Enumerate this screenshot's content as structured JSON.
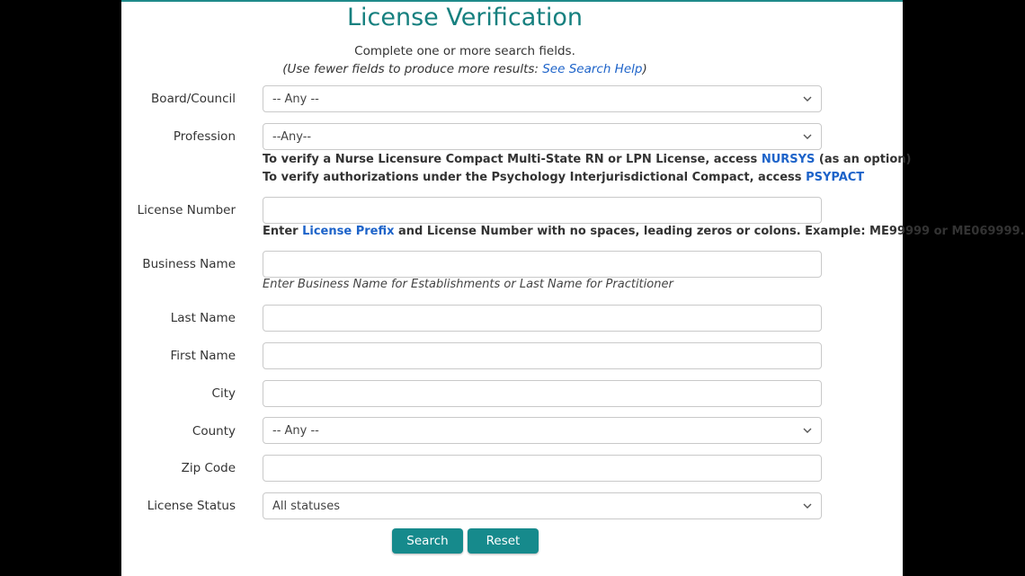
{
  "page": {
    "title": "License Verification",
    "instructions": "Complete one or more search fields.",
    "hint_prefix": "(Use fewer fields to produce more results: ",
    "hint_link": "See Search Help",
    "hint_suffix": ")"
  },
  "form": {
    "board": {
      "label": "Board/Council",
      "value": "-- Any --"
    },
    "profession": {
      "label": "Profession",
      "value": "--Any--"
    },
    "nursys_note": {
      "prefix": "To verify a Nurse Licensure Compact Multi-State RN or LPN License, access ",
      "link": "NURSYS",
      "suffix": " (as an option)"
    },
    "psypact_note": {
      "prefix": "To verify authorizations under the Psychology Interjurisdictional Compact, access ",
      "link": "PSYPACT"
    },
    "license_number": {
      "label": "License Number",
      "value": "",
      "placeholder": ""
    },
    "license_note": {
      "prefix": "Enter ",
      "link": "License Prefix",
      "suffix": " and License Number with no spaces, leading zeros or colons. Example: ME99999 or ME069999."
    },
    "business_name": {
      "label": "Business Name",
      "value": "",
      "placeholder": ""
    },
    "business_note": "Enter Business Name for Establishments or Last Name for Practitioner",
    "last_name": {
      "label": "Last Name",
      "value": "",
      "placeholder": ""
    },
    "first_name": {
      "label": "First Name",
      "value": "",
      "placeholder": ""
    },
    "city": {
      "label": "City",
      "value": "",
      "placeholder": ""
    },
    "county": {
      "label": "County",
      "value": "-- Any --"
    },
    "zip": {
      "label": "Zip Code",
      "value": "",
      "placeholder": ""
    },
    "status": {
      "label": "License Status",
      "value": "All statuses"
    }
  },
  "buttons": {
    "search": "Search",
    "reset": "Reset"
  },
  "colors": {
    "accent": "#168a8c",
    "title": "#16807f",
    "link": "#1d63c9"
  }
}
